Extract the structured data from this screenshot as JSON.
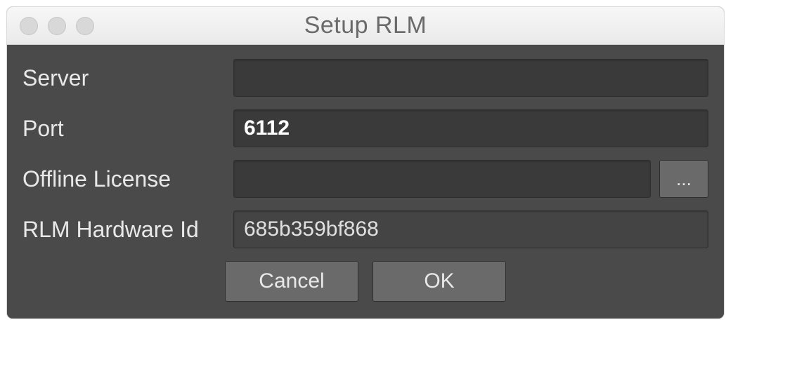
{
  "window": {
    "title": "Setup RLM"
  },
  "fields": {
    "server": {
      "label": "Server",
      "value": ""
    },
    "port": {
      "label": "Port",
      "value": "6112"
    },
    "offline_license": {
      "label": "Offline License",
      "value": "",
      "browse_label": "..."
    },
    "hardware_id": {
      "label": "RLM Hardware Id",
      "value": "685b359bf868"
    }
  },
  "buttons": {
    "cancel": "Cancel",
    "ok": "OK"
  }
}
